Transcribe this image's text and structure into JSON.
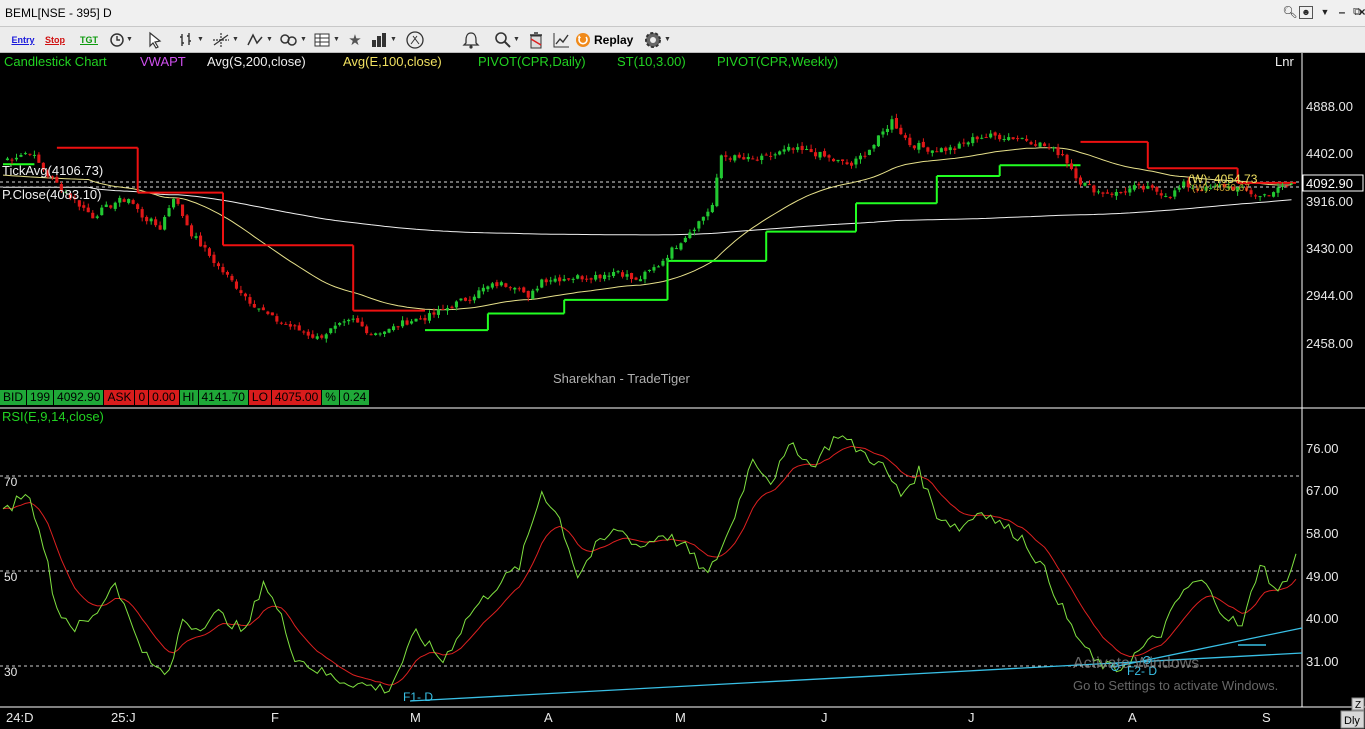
{
  "window": {
    "title": "BEML[NSE - 395] D",
    "controls": [
      "search-icon",
      "user-icon",
      "dropdown-icon",
      "minimize-icon",
      "restore-icon",
      "close-icon"
    ]
  },
  "toolbar": {
    "entry_label": "Entry",
    "stop_label": "Stop",
    "tgt_label": "TGT",
    "replay_label": "Replay",
    "icons": [
      "clock-icon",
      "cursor-icon",
      "bar-style-icon",
      "crosshair-icon",
      "line-tool-icon",
      "link-icon",
      "table-icon",
      "star-icon",
      "indicator-icon",
      "compass-icon",
      "alarm-icon",
      "zoom-icon",
      "trash-icon",
      "chart-line-icon",
      "replay-icon",
      "settings-gear-icon"
    ]
  },
  "legend": {
    "candlestick": "Candlestick Chart",
    "vwapt": "VWAPT",
    "avg200": "Avg(S,200,close)",
    "avg100": "Avg(E,100,close)",
    "pivot_daily": "PIVOT(CPR,Daily)",
    "st": "ST(10,3.00)",
    "pivot_weekly": "PIVOT(CPR,Weekly)",
    "scale": "Lnr"
  },
  "colors": {
    "up_candle": "#22c832",
    "down_candle": "#e01818",
    "supertrend_up": "#22ff22",
    "supertrend_down": "#ee1111",
    "sma200": "#f0f0f0",
    "ema100": "#e6e08a",
    "rsi": "#7fe040",
    "rsi_signal": "#dd2020",
    "trendline": "#39c0e6",
    "axis_text": "#e8e8e8",
    "watermark": "#b0b0b0"
  },
  "overlays": {
    "tickavg": "TickAvg(4106.73)",
    "pclose": "P.Close(4083.10)",
    "weekly_pivot": "(W): 4054.73",
    "weekly_pivot2": "(W): 4050.67",
    "watermark": "Sharekhan - TradeTiger",
    "last_price": "4092.90"
  },
  "price_axis": [
    "4888.00",
    "4402.00",
    "3916.00",
    "3430.00",
    "2944.00",
    "2458.00"
  ],
  "info_bar": {
    "bid_label": "BID",
    "bid_qty": "199",
    "bid_price": "4092.90",
    "ask_label": "ASK",
    "ask_qty": "0",
    "ask_price": "0.00",
    "hi_label": "HI",
    "hi_value": "4141.70",
    "lo_label": "LO",
    "lo_value": "4075.00",
    "pct_label": "%",
    "pct_value": "0.24"
  },
  "rsi": {
    "label": "RSI(E,9,14,close)",
    "left_levels": [
      "70",
      "50",
      "30"
    ],
    "axis": [
      "76.00",
      "67.00",
      "58.00",
      "49.00",
      "40.00",
      "31.00"
    ],
    "annotation1": "F1- D",
    "annotation2": "F2- D"
  },
  "time_axis": [
    "24:D",
    "25:J",
    "F",
    "M",
    "A",
    "M",
    "J",
    "J",
    "A",
    "S"
  ],
  "activation": {
    "line1": "Activate Windows",
    "line2": "Go to Settings to activate Windows."
  },
  "corner": {
    "z": "Z",
    "dly": "Dly"
  },
  "chart_data": {
    "type": "candlestick",
    "title": "BEML[NSE - 395] D",
    "y_axis_price": {
      "min": 2300,
      "max": 5000,
      "ticks": [
        4888.0,
        4402.0,
        3916.0,
        3430.0,
        2944.0,
        2458.0
      ]
    },
    "y_axis_rsi": {
      "min": 20,
      "max": 82,
      "ticks": [
        76,
        67,
        58,
        49,
        40,
        31
      ],
      "levels": [
        70,
        50,
        30
      ]
    },
    "x_labels": [
      "24:D",
      "25:J",
      "F",
      "M",
      "A",
      "M",
      "J",
      "J",
      "A",
      "S"
    ],
    "price_anchors": [
      [
        0,
        4330
      ],
      [
        6,
        4420
      ],
      [
        10,
        4180
      ],
      [
        15,
        3960
      ],
      [
        20,
        3760
      ],
      [
        25,
        3900
      ],
      [
        28,
        3940
      ],
      [
        31,
        3760
      ],
      [
        35,
        3640
      ],
      [
        38,
        3960
      ],
      [
        42,
        3580
      ],
      [
        48,
        3240
      ],
      [
        55,
        2890
      ],
      [
        60,
        2710
      ],
      [
        66,
        2590
      ],
      [
        70,
        2510
      ],
      [
        73,
        2590
      ],
      [
        78,
        2690
      ],
      [
        82,
        2560
      ],
      [
        86,
        2590
      ],
      [
        90,
        2680
      ],
      [
        95,
        2730
      ],
      [
        100,
        2840
      ],
      [
        104,
        2930
      ],
      [
        107,
        3010
      ],
      [
        110,
        3060
      ],
      [
        115,
        3050
      ],
      [
        117,
        2900
      ],
      [
        120,
        3110
      ],
      [
        127,
        3130
      ],
      [
        133,
        3150
      ],
      [
        137,
        3200
      ],
      [
        141,
        3090
      ],
      [
        146,
        3260
      ],
      [
        151,
        3510
      ],
      [
        155,
        3700
      ],
      [
        158,
        3870
      ],
      [
        160,
        4380
      ],
      [
        165,
        4340
      ],
      [
        168,
        4330
      ],
      [
        175,
        4440
      ],
      [
        180,
        4420
      ],
      [
        185,
        4330
      ],
      [
        189,
        4280
      ],
      [
        194,
        4490
      ],
      [
        198,
        4740
      ],
      [
        202,
        4500
      ],
      [
        207,
        4440
      ],
      [
        212,
        4450
      ],
      [
        217,
        4570
      ],
      [
        221,
        4580
      ],
      [
        227,
        4560
      ],
      [
        232,
        4480
      ],
      [
        236,
        4390
      ],
      [
        240,
        4110
      ],
      [
        244,
        4010
      ],
      [
        248,
        3990
      ],
      [
        252,
        4050
      ],
      [
        256,
        4030
      ],
      [
        260,
        3970
      ],
      [
        263,
        4080
      ],
      [
        268,
        4030
      ],
      [
        272,
        4070
      ],
      [
        276,
        4030
      ],
      [
        280,
        3960
      ],
      [
        284,
        4030
      ],
      [
        287,
        4092
      ]
    ],
    "rsi_anchors": [
      [
        0,
        62
      ],
      [
        5,
        67
      ],
      [
        8,
        60
      ],
      [
        12,
        42
      ],
      [
        16,
        38
      ],
      [
        20,
        40
      ],
      [
        25,
        48
      ],
      [
        28,
        40
      ],
      [
        33,
        30
      ],
      [
        37,
        28
      ],
      [
        40,
        40
      ],
      [
        43,
        38
      ],
      [
        48,
        41
      ],
      [
        54,
        37
      ],
      [
        58,
        48
      ],
      [
        62,
        40
      ],
      [
        65,
        32
      ],
      [
        70,
        29
      ],
      [
        75,
        27
      ],
      [
        80,
        26
      ],
      [
        86,
        25
      ],
      [
        92,
        37
      ],
      [
        98,
        31
      ],
      [
        104,
        41
      ],
      [
        110,
        47
      ],
      [
        115,
        51
      ],
      [
        120,
        67
      ],
      [
        124,
        61
      ],
      [
        128,
        49
      ],
      [
        132,
        55
      ],
      [
        137,
        59
      ],
      [
        142,
        55
      ],
      [
        147,
        58
      ],
      [
        152,
        55
      ],
      [
        157,
        49
      ],
      [
        162,
        59
      ],
      [
        167,
        74
      ],
      [
        171,
        69
      ],
      [
        176,
        77
      ],
      [
        180,
        72
      ],
      [
        186,
        79
      ],
      [
        190,
        76
      ],
      [
        196,
        72
      ],
      [
        200,
        66
      ],
      [
        204,
        71
      ],
      [
        208,
        62
      ],
      [
        213,
        59
      ],
      [
        218,
        63
      ],
      [
        222,
        60
      ],
      [
        227,
        57
      ],
      [
        232,
        50
      ],
      [
        238,
        38
      ],
      [
        243,
        31
      ],
      [
        248,
        29
      ],
      [
        253,
        33
      ],
      [
        258,
        37
      ],
      [
        263,
        46
      ],
      [
        267,
        48
      ],
      [
        272,
        41
      ],
      [
        276,
        38
      ],
      [
        280,
        52
      ],
      [
        284,
        45
      ],
      [
        288,
        53
      ]
    ],
    "supertrend": [
      {
        "from": 0,
        "to": 7,
        "value": 4290,
        "dir": "up"
      },
      {
        "from": 12,
        "to": 30,
        "value": 4460,
        "dir": "down"
      },
      {
        "from": 30,
        "to": 49,
        "value": 4000,
        "dir": "down"
      },
      {
        "from": 49,
        "to": 78,
        "value": 3460,
        "dir": "down"
      },
      {
        "from": 78,
        "to": 94,
        "value": 2790,
        "dir": "down"
      },
      {
        "from": 94,
        "to": 108,
        "value": 2590,
        "dir": "up"
      },
      {
        "from": 108,
        "to": 125,
        "value": 2760,
        "dir": "up"
      },
      {
        "from": 125,
        "to": 148,
        "value": 2900,
        "dir": "up"
      },
      {
        "from": 148,
        "to": 170,
        "value": 3300,
        "dir": "up"
      },
      {
        "from": 170,
        "to": 190,
        "value": 3600,
        "dir": "up"
      },
      {
        "from": 190,
        "to": 208,
        "value": 3890,
        "dir": "up"
      },
      {
        "from": 208,
        "to": 222,
        "value": 4170,
        "dir": "up"
      },
      {
        "from": 222,
        "to": 240,
        "value": 4280,
        "dir": "up"
      },
      {
        "from": 240,
        "to": 255,
        "value": 4520,
        "dir": "down"
      },
      {
        "from": 255,
        "to": 275,
        "value": 4250,
        "dir": "down"
      },
      {
        "from": 275,
        "to": 288,
        "value": 4100,
        "dir": "down"
      }
    ]
  }
}
